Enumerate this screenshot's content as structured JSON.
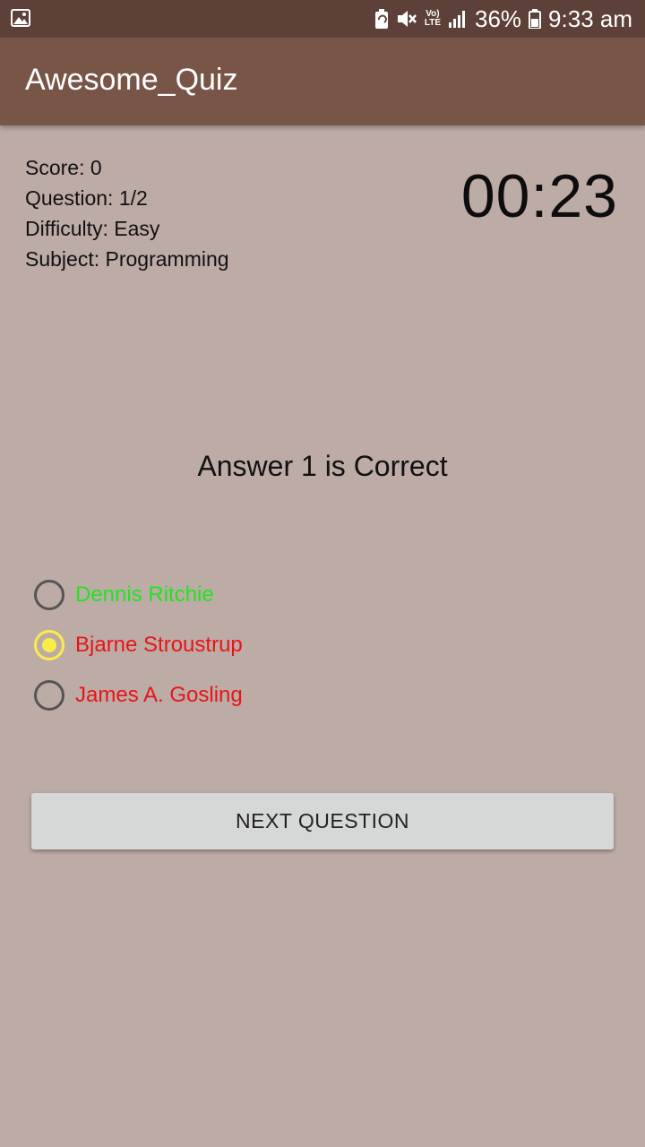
{
  "status_bar": {
    "battery": "36%",
    "time": "9:33 am",
    "network": "LTE",
    "icons": [
      "image-icon",
      "battery-saver-icon",
      "mute-icon",
      "volte-icon",
      "signal-icon",
      "battery-icon"
    ]
  },
  "app_bar": {
    "title": "Awesome_Quiz"
  },
  "info": {
    "score": "Score: 0",
    "question": "Question: 1/2",
    "difficulty": "Difficulty: Easy",
    "subject": "Subject: Programming"
  },
  "timer": "00:23",
  "result_text": "Answer 1 is Correct",
  "options": [
    {
      "label": "Dennis Ritchie",
      "color": "#21e41f",
      "checked": false
    },
    {
      "label": "Bjarne Stroustrup",
      "color": "#e8141a",
      "checked": true
    },
    {
      "label": "James A. Gosling",
      "color": "#e8141a",
      "checked": false
    }
  ],
  "next_button": "NEXT QUESTION",
  "colors": {
    "status_bar": "#5d4037",
    "app_bar": "#795548",
    "background": "#bcaca5",
    "radio_checked": "#fdeb4a"
  }
}
